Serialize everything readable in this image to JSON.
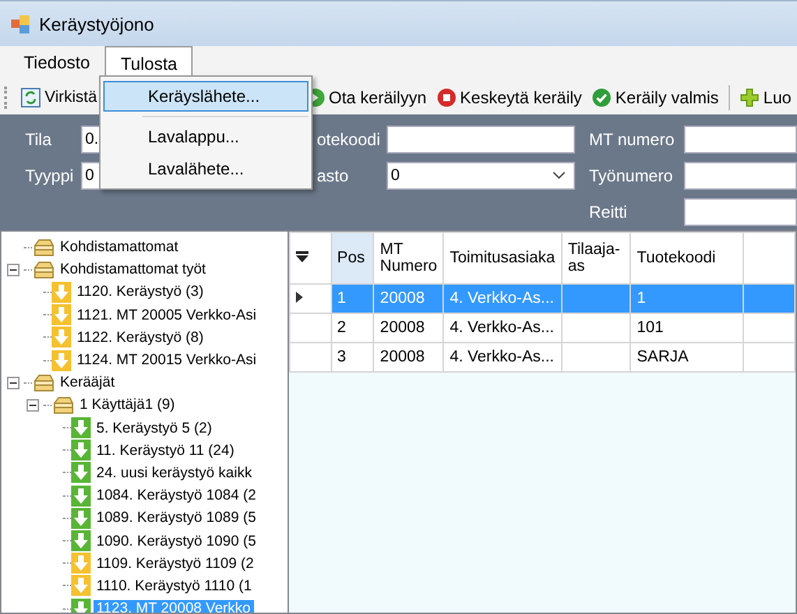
{
  "window": {
    "title": "Keräystyöjono"
  },
  "menu": [
    {
      "label": "Tiedosto",
      "selected": false
    },
    {
      "label": "Tulosta",
      "selected": true
    }
  ],
  "dropdown": [
    {
      "label": "Keräyslähete...",
      "selected": true
    },
    {
      "label": "Lavalappu...",
      "selected": false
    },
    {
      "label": "Lavalähete...",
      "selected": false
    }
  ],
  "toolbar": [
    {
      "label": "Virkistä",
      "kind": "refresh"
    },
    {
      "label": "Ota keräilyyn",
      "kind": "take"
    },
    {
      "label": "Keskeytä keräily",
      "kind": "stop"
    },
    {
      "label": "Keräily valmis",
      "kind": "done"
    },
    {
      "label": "Luo",
      "kind": "create"
    }
  ],
  "filters": {
    "row_1": [
      {
        "label": "Tila",
        "value": "0.",
        "kind": "text"
      },
      {
        "label": "otekoodi",
        "kind": "text"
      },
      {
        "label": "MT numero",
        "kind": "text"
      }
    ],
    "row_2": [
      {
        "label": "Tyyppi",
        "value": "0",
        "kind": "text"
      },
      {
        "label": "asto",
        "value": "0",
        "kind": "combo"
      },
      {
        "label": "Työnumero",
        "kind": "text"
      }
    ],
    "row_3": [
      {
        "label": "Reitti",
        "kind": "text"
      }
    ]
  },
  "tree": [
    {
      "label": "Kohdistamattomat",
      "kind": "group",
      "selected": false
    },
    {
      "label": "Kohdistamattomat työt",
      "kind": "group",
      "expanded": true,
      "selected": false,
      "children": [
        {
          "label": "1120. Keräystyö (3)",
          "kind": "job",
          "color": "#f6c12f",
          "selected": false
        },
        {
          "label": "1121. MT 20005 Verkko-Asi",
          "kind": "job",
          "color": "#f6c12f",
          "selected": false
        },
        {
          "label": "1122. Keräystyö (8)",
          "kind": "job",
          "color": "#f6c12f",
          "selected": false
        },
        {
          "label": "1124. MT 20015 Verkko-Asi",
          "kind": "job",
          "color": "#f6c12f",
          "selected": false
        }
      ]
    },
    {
      "label": "Kerääjät",
      "kind": "group",
      "expanded": true,
      "selected": false,
      "children": [
        {
          "label": "1 Käyttäjä1 (9)",
          "kind": "group",
          "expanded": true,
          "selected": false,
          "children": [
            {
              "label": "5. Keräystyö 5 (2)",
              "kind": "job",
              "color": "#58b535",
              "selected": false
            },
            {
              "label": "11. Keräystyö 11 (24)",
              "kind": "job",
              "color": "#58b535",
              "selected": false
            },
            {
              "label": "24. uusi keräystyö kaikk",
              "kind": "job",
              "color": "#58b535",
              "selected": false
            },
            {
              "label": "1084. Keräystyö 1084 (2",
              "kind": "job",
              "color": "#58b535",
              "selected": false
            },
            {
              "label": "1089. Keräystyö 1089 (5",
              "kind": "job",
              "color": "#58b535",
              "selected": false
            },
            {
              "label": "1090. Keräystyö 1090 (5",
              "kind": "job",
              "color": "#58b535",
              "selected": false
            },
            {
              "label": "1109. Keräystyö 1109 (2",
              "kind": "job",
              "color": "#f6c12f",
              "selected": false
            },
            {
              "label": "1110. Keräystyö 1110 (1",
              "kind": "job",
              "color": "#f6c12f",
              "selected": false
            },
            {
              "label": "1123. MT 20008 Verkko",
              "kind": "job",
              "color": "#58b535",
              "selected": true
            }
          ]
        }
      ]
    }
  ],
  "table": {
    "columns": [
      "Pos",
      "MT Numero",
      "Toimitusasiaka",
      "Tilaaja-as",
      "Tuotekoodi"
    ],
    "rows": [
      {
        "selected": true,
        "cells": [
          "1",
          "20008",
          "4. Verkko-As...",
          "",
          "1"
        ]
      },
      {
        "selected": false,
        "cells": [
          "2",
          "20008",
          "4. Verkko-As...",
          "",
          "101"
        ]
      },
      {
        "selected": false,
        "cells": [
          "3",
          "20008",
          "4. Verkko-As...",
          "",
          "SARJA"
        ]
      }
    ]
  }
}
